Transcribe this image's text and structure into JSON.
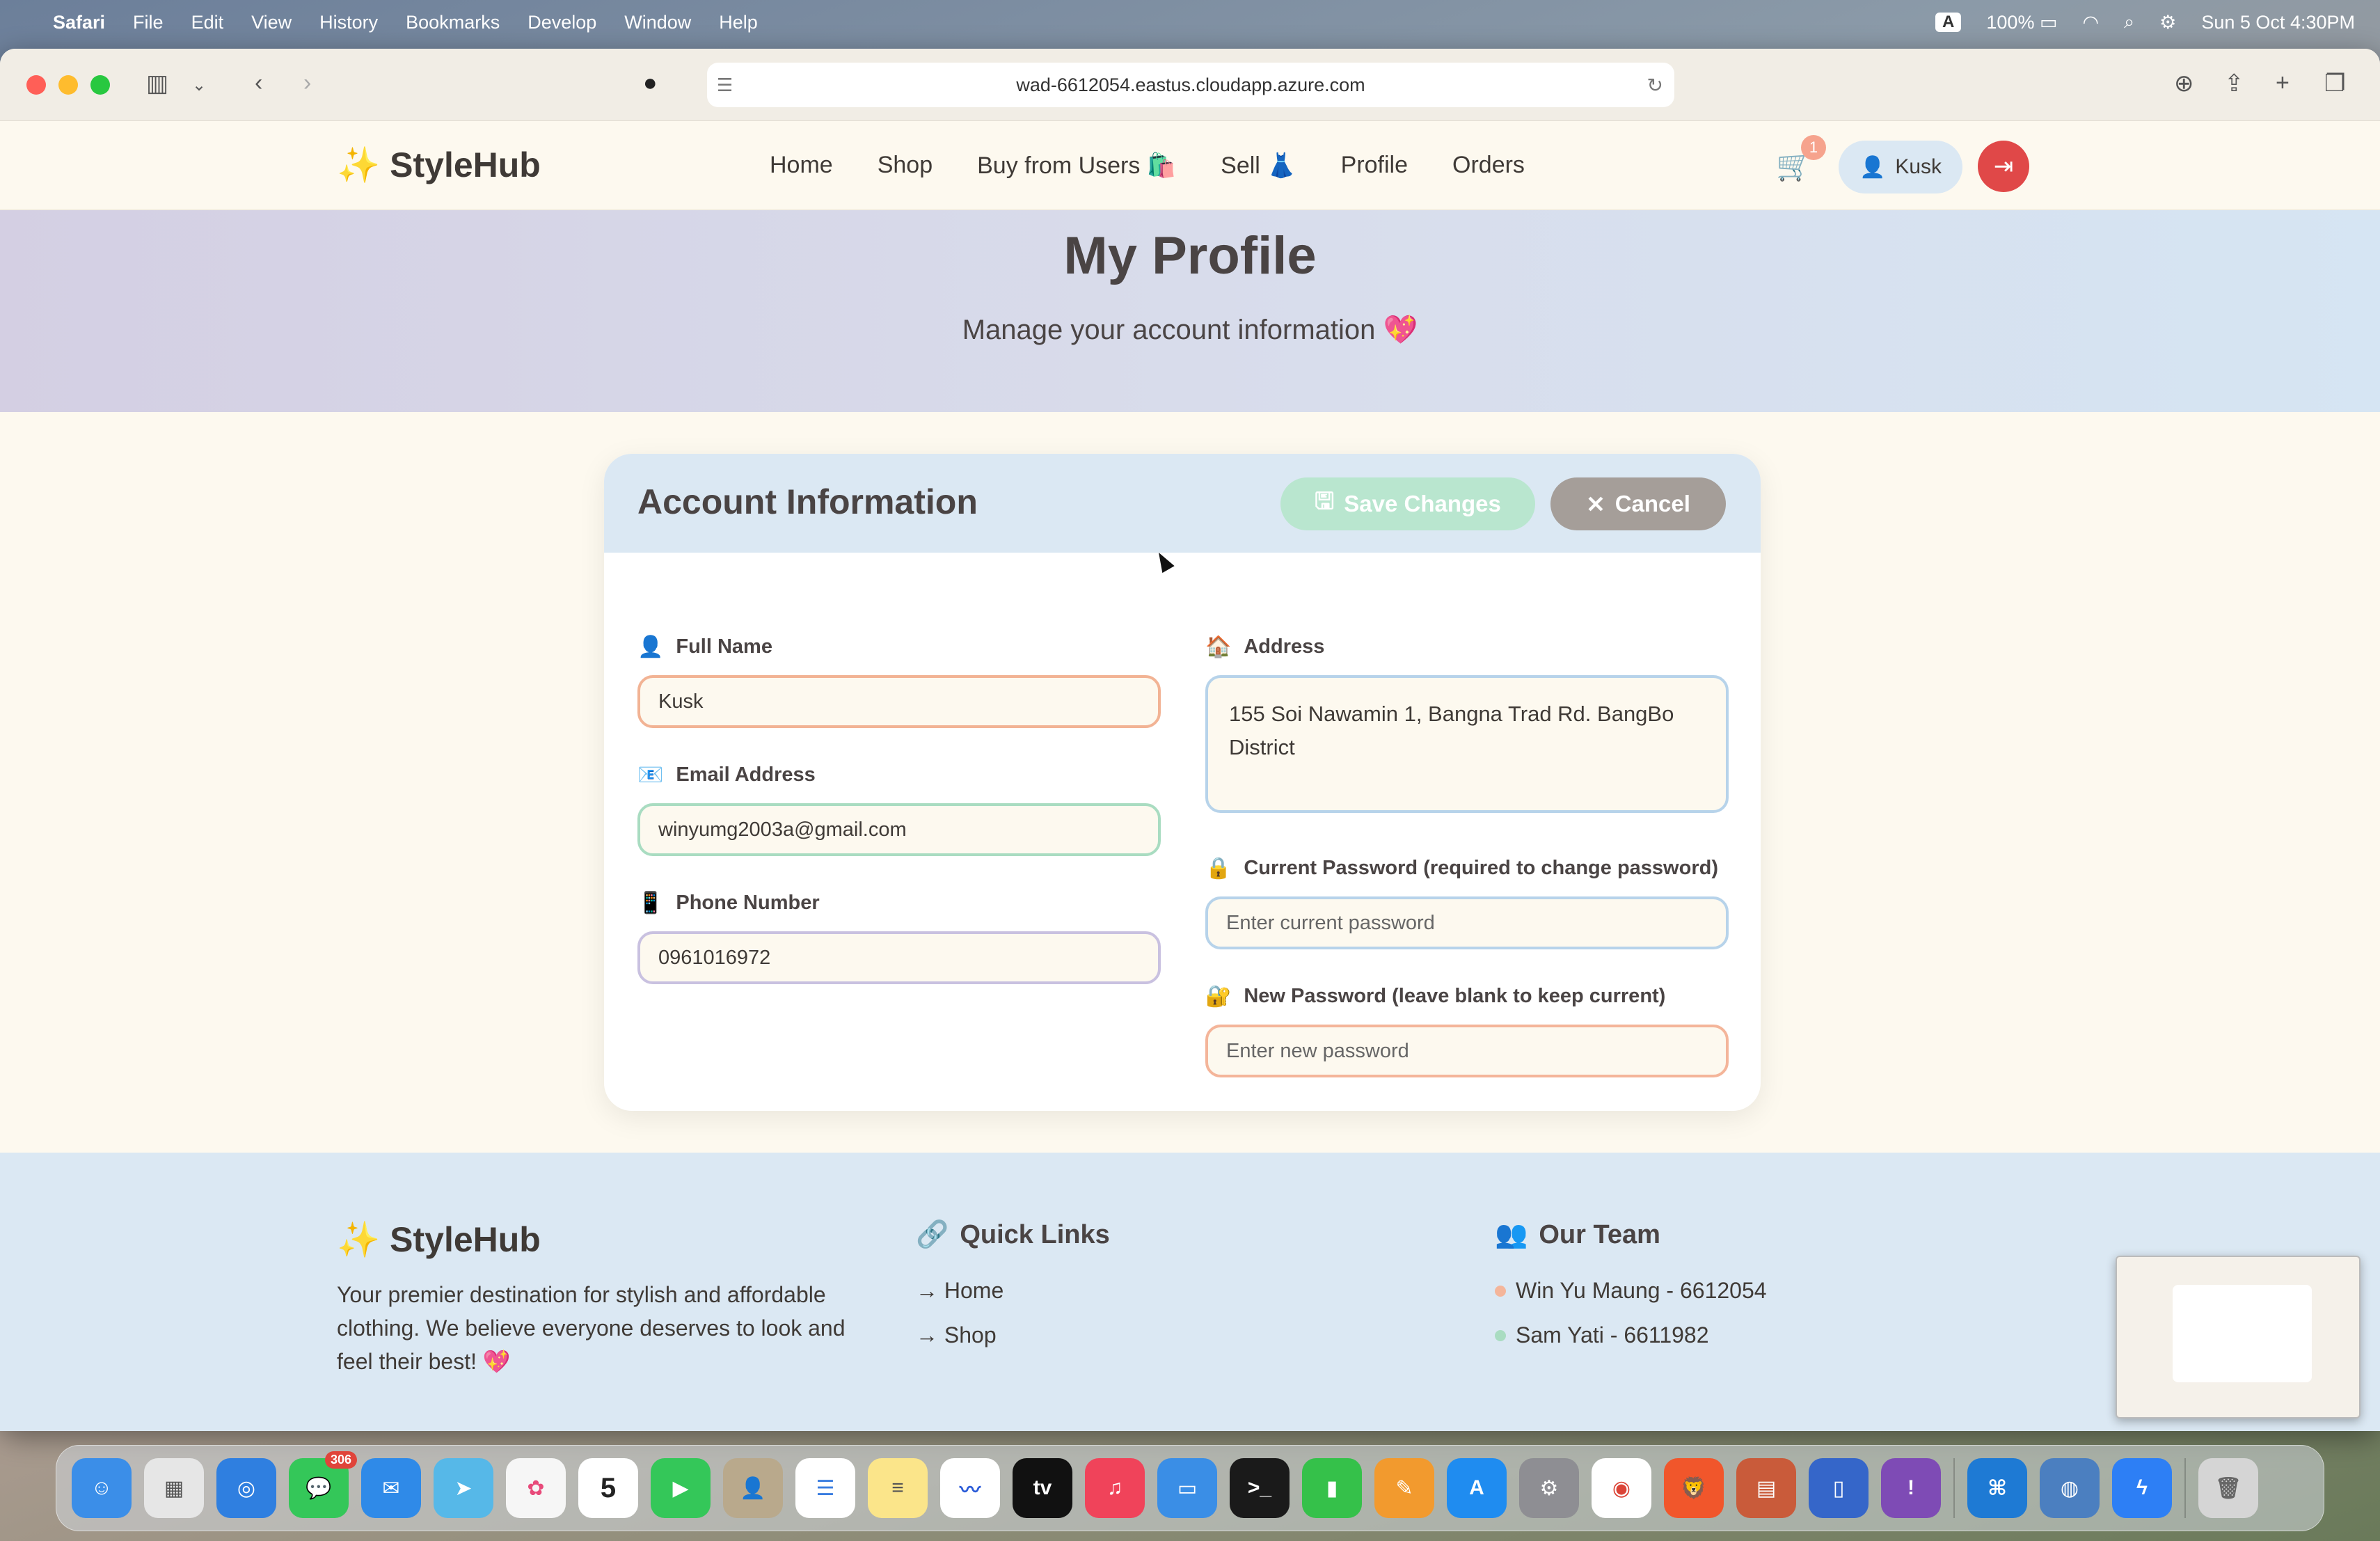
{
  "menubar": {
    "items": [
      "Safari",
      "File",
      "Edit",
      "View",
      "History",
      "Bookmarks",
      "Develop",
      "Window",
      "Help"
    ],
    "input_badge": "A",
    "battery": "100%",
    "datetime": "Sun 5 Oct  4:30PM"
  },
  "browser": {
    "url": "wad-6612054.eastus.cloudapp.azure.com"
  },
  "site": {
    "logo": "✨ StyleHub",
    "nav": [
      "Home",
      "Shop",
      "Buy from Users 🛍️",
      "Sell 👗",
      "Profile",
      "Orders"
    ],
    "cart_count": "1",
    "user": "Kusk"
  },
  "hero": {
    "title": "My Profile",
    "subtitle": "Manage your account information 💖"
  },
  "account": {
    "heading": "Account Information",
    "save_label": "Save Changes",
    "cancel_label": "Cancel",
    "full_name_label": "Full Name",
    "full_name_value": "Kusk",
    "email_label": "Email Address",
    "email_value": "winyumg2003a@gmail.com",
    "phone_label": "Phone Number",
    "phone_value": "0961016972",
    "address_label": "Address",
    "address_value": "155 Soi Nawamin 1, Bangna Trad Rd. BangBo District",
    "current_pw_label": "Current Password (required to change password)",
    "current_pw_placeholder": "Enter current password",
    "new_pw_label": "New Password (leave blank to keep current)",
    "new_pw_placeholder": "Enter new password"
  },
  "footer": {
    "logo": "✨ StyleHub",
    "description": "Your premier destination for stylish and affordable clothing. We believe everyone deserves to look and feel their best! 💖",
    "quick_links_heading": "Quick Links",
    "quick_links": [
      "→ Home",
      "→ Shop"
    ],
    "team_heading": "Our Team",
    "team": [
      "Win Yu Maung - 6612054",
      "Sam Yati - 6611982"
    ]
  },
  "dock": {
    "messages_badge": "306",
    "calendar_day": "5"
  },
  "colors": {
    "accent_red": "#e04848",
    "save_green": "#b9e6cf",
    "cancel_gray": "#a59e99",
    "panel_blue": "#dbe8f3"
  }
}
